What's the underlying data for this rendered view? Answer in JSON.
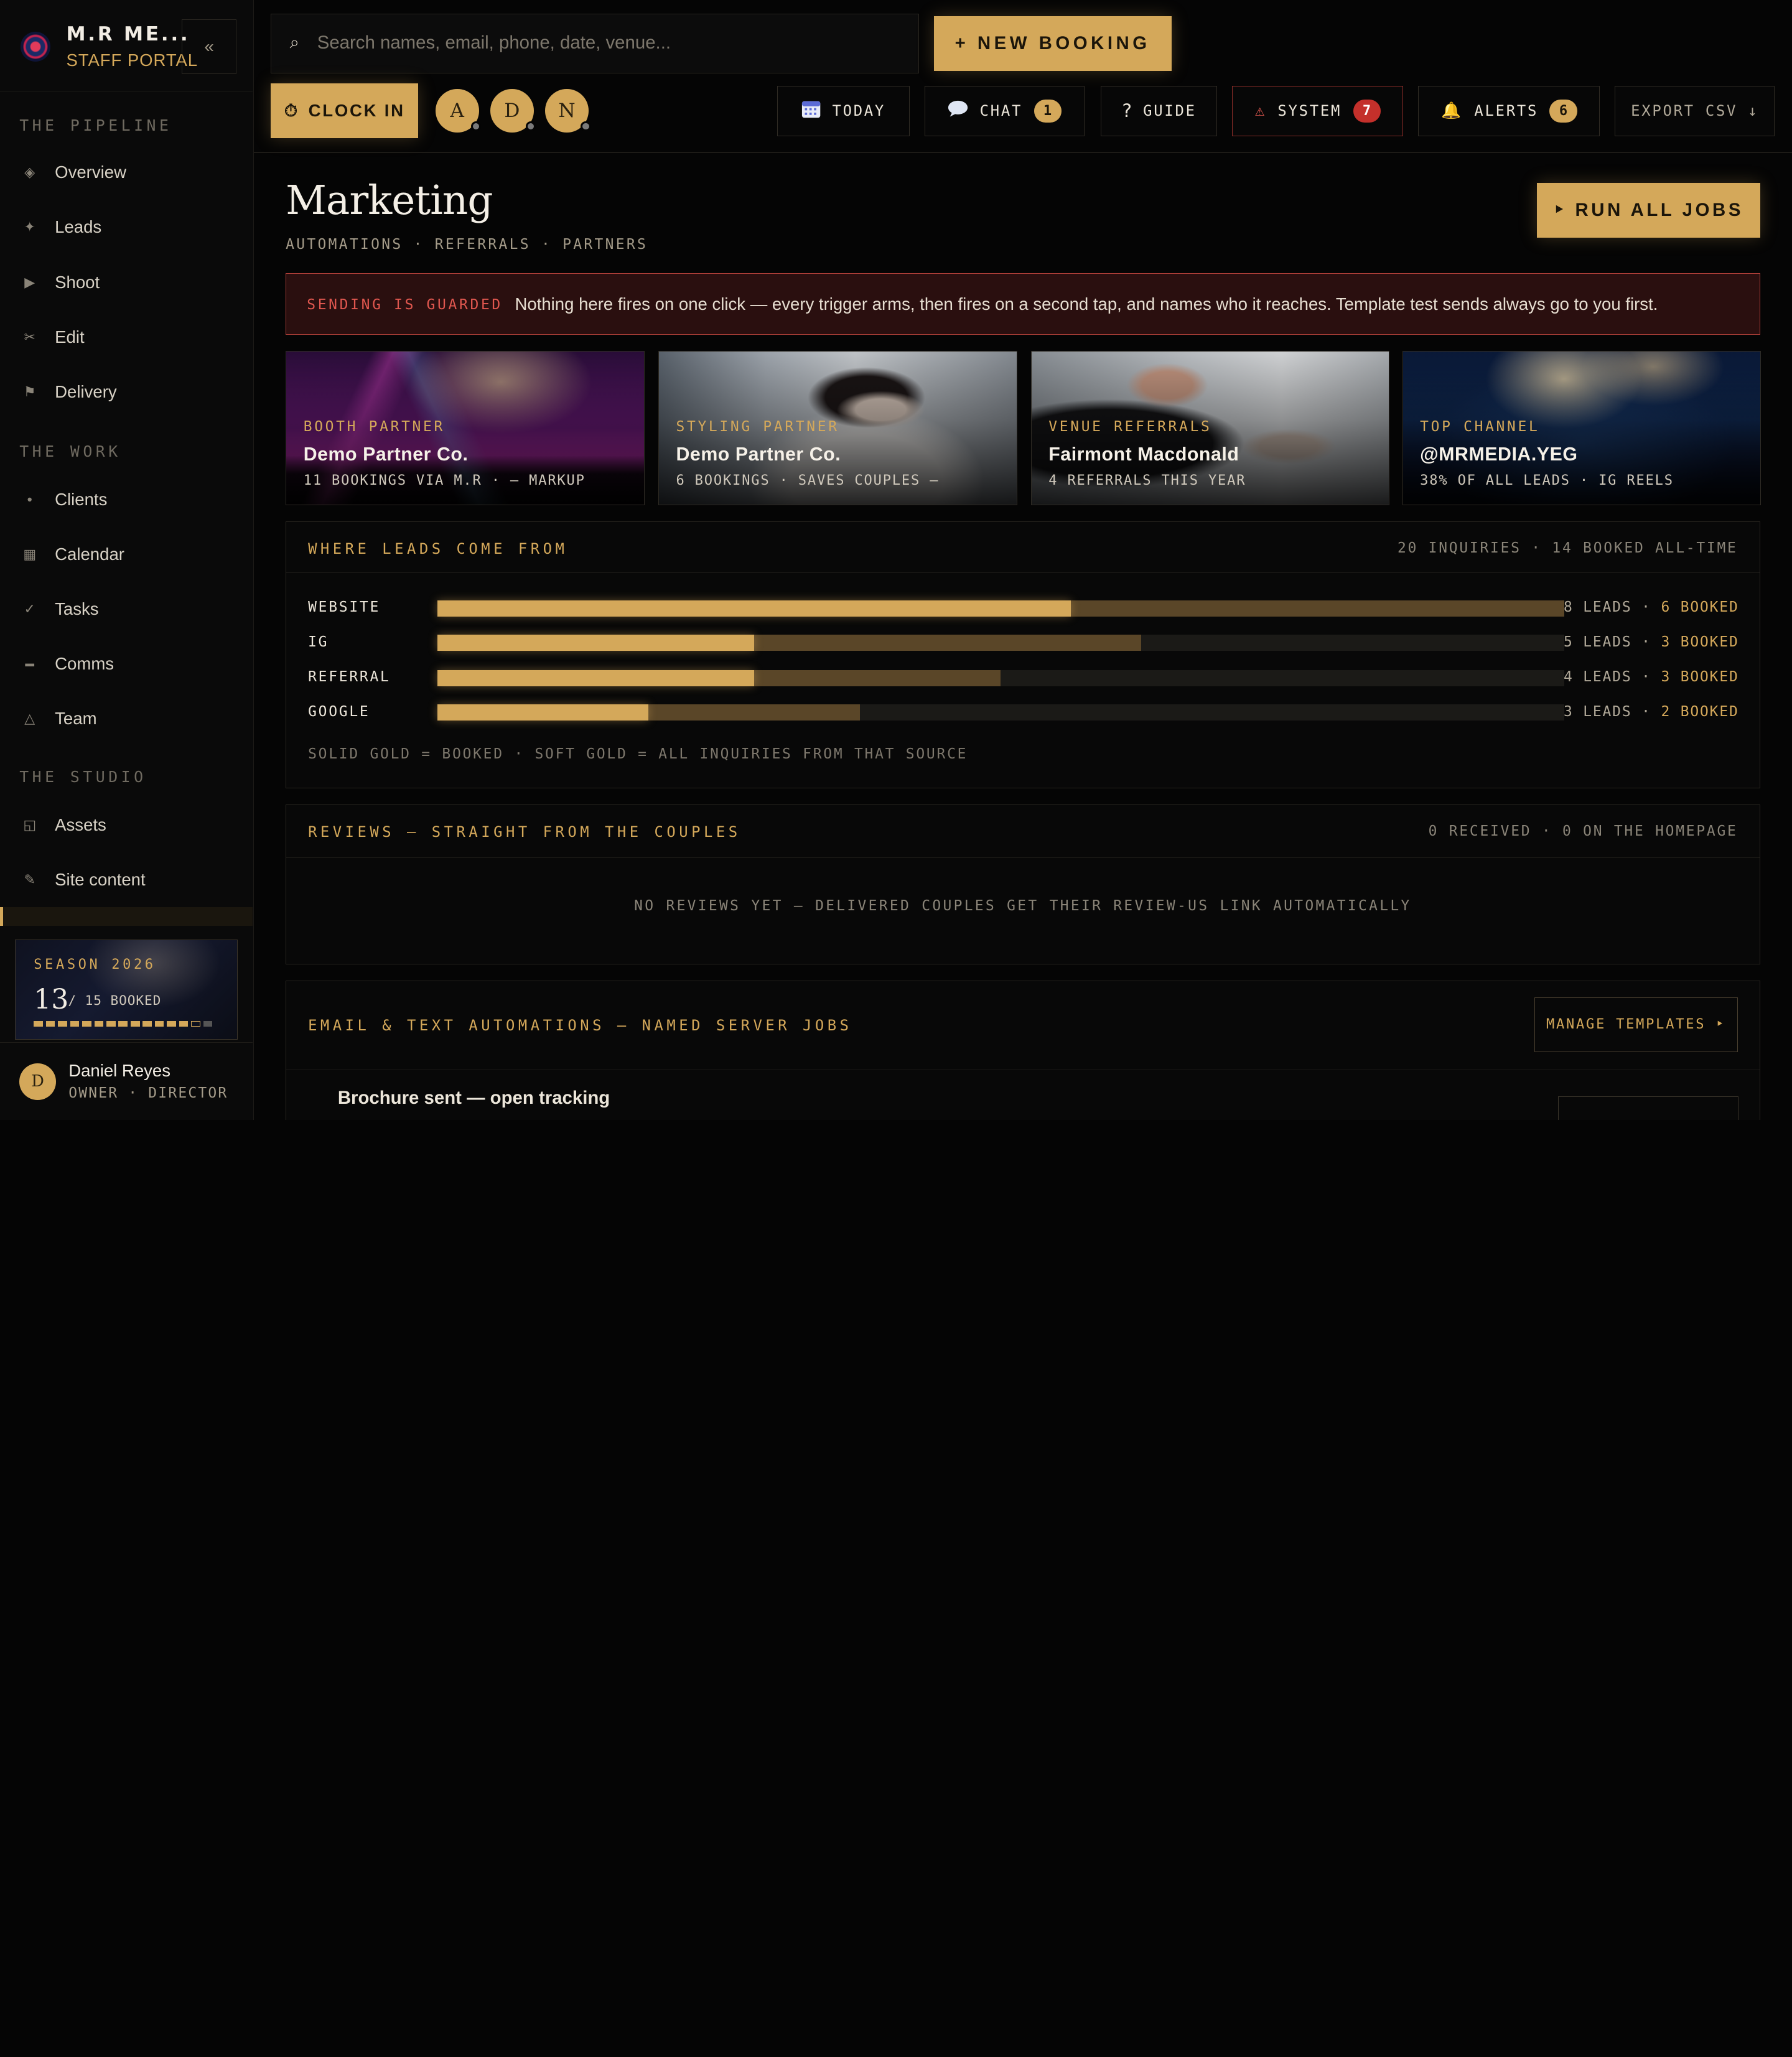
{
  "brand": {
    "name": "M.R ME...",
    "subtitle": "STAFF PORTAL",
    "collapse_icon": "«"
  },
  "nav": {
    "sections": [
      {
        "title": "THE PIPELINE",
        "items": [
          {
            "label": "Overview",
            "icon": "◈"
          },
          {
            "label": "Leads",
            "icon": "✦"
          },
          {
            "label": "Shoot",
            "icon": "▶"
          },
          {
            "label": "Edit",
            "icon": "✂"
          },
          {
            "label": "Delivery",
            "icon": "⚑"
          }
        ]
      },
      {
        "title": "THE WORK",
        "items": [
          {
            "label": "Clients",
            "icon": "●"
          },
          {
            "label": "Calendar",
            "icon": "▦"
          },
          {
            "label": "Tasks",
            "icon": "✓"
          },
          {
            "label": "Comms",
            "icon": "▬"
          },
          {
            "label": "Team",
            "icon": "△"
          }
        ]
      },
      {
        "title": "THE STUDIO",
        "items": [
          {
            "label": "Assets",
            "icon": "◱"
          },
          {
            "label": "Site content",
            "icon": "✎"
          }
        ]
      }
    ]
  },
  "season": {
    "label": "SEASON 2026",
    "booked": "13",
    "of_total": "/ 15 BOOKED",
    "booked_count": 13,
    "total": 15
  },
  "user": {
    "initial": "D",
    "name": "Daniel Reyes",
    "role": "OWNER · DIRECTOR"
  },
  "topbar": {
    "search_icon": "⌕",
    "search_placeholder": "Search names, email, phone, date, venue...",
    "new_booking": "+ NEW BOOKING",
    "clock_in_icon": "⏱",
    "clock_in": "CLOCK IN",
    "presence": [
      "A",
      "D",
      "N"
    ],
    "today": "TODAY",
    "chat": "CHAT",
    "chat_count": "1",
    "guide_icon": "?",
    "guide": "GUIDE",
    "system_icon": "⚠",
    "system": "SYSTEM",
    "system_count": "7",
    "alerts_icon": "🔔",
    "alerts": "ALERTS",
    "alerts_count": "6",
    "export": "EXPORT CSV ↓"
  },
  "page": {
    "title": "Marketing",
    "subtitle": "AUTOMATIONS · REFERRALS · PARTNERS",
    "run_all": "‣ RUN ALL JOBS"
  },
  "guard": {
    "tag": "SENDING IS GUARDED",
    "text": "Nothing here fires on one click — every trigger arms, then fires on a second tap, and names who it reaches. Template test sends always go to you first."
  },
  "cards": [
    {
      "kicker": "BOOTH PARTNER",
      "title": "Demo Partner Co.",
      "stat": "11 BOOKINGS VIA M.R · — MARKUP"
    },
    {
      "kicker": "STYLING PARTNER",
      "title": "Demo Partner Co.",
      "stat": "6 BOOKINGS · SAVES COUPLES —"
    },
    {
      "kicker": "VENUE REFERRALS",
      "title": "Fairmont Macdonald",
      "stat": "4 REFERRALS THIS YEAR"
    },
    {
      "kicker": "TOP CHANNEL",
      "title": "@MRMEDIA.YEG",
      "stat": "38% OF ALL LEADS · IG REELS"
    }
  ],
  "leads": {
    "title": "WHERE LEADS COME FROM",
    "meta": "20 INQUIRIES · 14 BOOKED ALL-TIME",
    "max": 8,
    "sources": [
      {
        "name": "WEBSITE",
        "leads": 8,
        "booked": 6,
        "leads_label": "8 LEADS ·",
        "booked_label": "6 BOOKED"
      },
      {
        "name": "IG",
        "leads": 5,
        "booked": 3,
        "leads_label": "5 LEADS ·",
        "booked_label": "3 BOOKED"
      },
      {
        "name": "REFERRAL",
        "leads": 4,
        "booked": 3,
        "leads_label": "4 LEADS ·",
        "booked_label": "3 BOOKED"
      },
      {
        "name": "GOOGLE",
        "leads": 3,
        "booked": 2,
        "leads_label": "3 LEADS ·",
        "booked_label": "2 BOOKED"
      }
    ],
    "note": "SOLID GOLD = BOOKED · SOFT GOLD = ALL INQUIRIES FROM THAT SOURCE"
  },
  "reviews": {
    "title": "REVIEWS — STRAIGHT FROM THE COUPLES",
    "meta": "0 RECEIVED · 0 ON THE HOMEPAGE",
    "empty": "NO REVIEWS YET — DELIVERED COUPLES GET THEIR REVIEW-US LINK AUTOMATICALLY"
  },
  "automations": {
    "title": "EMAIL & TEXT AUTOMATIONS — NAMED SERVER JOBS",
    "manage": "MANAGE TEMPLATES ‣",
    "first_job": "Brochure sent — open tracking"
  }
}
